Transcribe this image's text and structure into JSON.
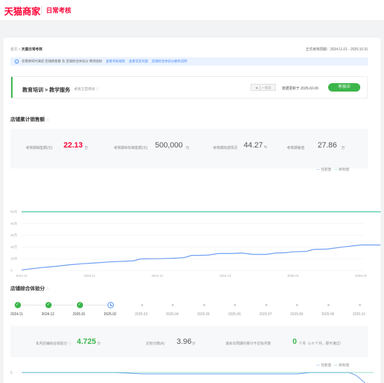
{
  "header": {
    "brand": "天猫商家",
    "subtitle": "日常考核"
  },
  "breadcrumb": {
    "parent": "首页",
    "separator": ">",
    "current": "天猫日常考核"
  },
  "period": "正式考核周期：2024.11.01 - 2025.10.31",
  "notice": {
    "text": "您需要同时满足 店铺销售额 及 店铺综合体验分 两项指标",
    "links": [
      "查看考核规则",
      "查看常见问题",
      "店铺综合体验分解析说明"
    ]
  },
  "category": {
    "path": "教育培训 > 教学服务",
    "kind": "考核主营类目",
    "prev_button": "◀ 上一级类",
    "updated": "数据更新于 2025-02-09",
    "status_button": "考核中"
  },
  "sales": {
    "title": "店铺累计销售额",
    "stats": [
      {
        "label": "考核期销售额(元)",
        "value": "22.13",
        "unit": "万"
      },
      {
        "label": "考核期目标销售额(元)",
        "value": "500,000",
        "unit": "元"
      },
      {
        "label": "考核期完成情况",
        "value": "44.27",
        "unit": "%"
      },
      {
        "label": "考核期差值",
        "value": "27.86",
        "unit": "万"
      }
    ],
    "legend": [
      "当前值",
      "目标值"
    ]
  },
  "chart_data": {
    "type": "line",
    "x_start": "2024-11-01",
    "x_end": "2025-02-09",
    "xticks": [
      "2024.11",
      "2024.11",
      "2024.12",
      "2024.12",
      "2025.01",
      "2025.02"
    ],
    "yticks": [
      "0",
      "10万",
      "20万",
      "30万",
      "40万",
      "50万"
    ],
    "ylim": [
      0,
      50
    ],
    "series": [
      {
        "name": "当前值",
        "color": "#6b9cf2",
        "points": [
          [
            0,
            0.5
          ],
          [
            3,
            1.5
          ],
          [
            6,
            2.5
          ],
          [
            10,
            3.5
          ],
          [
            14,
            4.8
          ],
          [
            18,
            5.8
          ],
          [
            22,
            6.5
          ],
          [
            26,
            7.3
          ],
          [
            30,
            7.8
          ],
          [
            33,
            8.3
          ],
          [
            35,
            9.8
          ],
          [
            40,
            10
          ],
          [
            45,
            10.4
          ],
          [
            48,
            11
          ],
          [
            50,
            12.8
          ],
          [
            52,
            12.8
          ],
          [
            55,
            13.1
          ],
          [
            58,
            14.5
          ],
          [
            62,
            14.5
          ],
          [
            65,
            14.9
          ],
          [
            68,
            13.7
          ],
          [
            72,
            13.7
          ],
          [
            75,
            14.9
          ],
          [
            78,
            15.2
          ],
          [
            80,
            15.9
          ],
          [
            84,
            16.3
          ],
          [
            86,
            17.9
          ],
          [
            90,
            18.2
          ],
          [
            95,
            20.1
          ],
          [
            100,
            21.7
          ],
          [
            105,
            21.7
          ],
          [
            110,
            21.7
          ],
          [
            115,
            21.7
          ],
          [
            120,
            22.2
          ],
          [
            125,
            22.1
          ]
        ]
      },
      {
        "name": "目标值",
        "color": "#3cc8a0",
        "points": [
          [
            0,
            50
          ],
          [
            125,
            50
          ]
        ]
      }
    ]
  },
  "experience": {
    "title": "店铺综合体验分",
    "months": [
      {
        "label": "2024.11",
        "state": "done"
      },
      {
        "label": "2024.12",
        "state": "done"
      },
      {
        "label": "2025.01",
        "state": "done"
      },
      {
        "label": "2025.02",
        "state": "current"
      },
      {
        "label": "2025.03",
        "state": "future"
      },
      {
        "label": "2025.04",
        "state": "future"
      },
      {
        "label": "2025.05",
        "state": "future"
      },
      {
        "label": "2025.06",
        "state": "future"
      },
      {
        "label": "2025.07",
        "state": "future"
      },
      {
        "label": "2025.08",
        "state": "future"
      },
      {
        "label": "2025.09",
        "state": "future"
      },
      {
        "label": "2025.10",
        "state": "future"
      }
    ],
    "scores": [
      {
        "label": "本月店铺综合体验分",
        "value": "4.725",
        "unit": "分"
      },
      {
        "label": "达标分数(A)",
        "value": "3.96",
        "unit": "分"
      },
      {
        "label": "滚余日周期内累计不达标月数",
        "value": "0",
        "unit": "个月（≥ 6 个月，即不通过）"
      }
    ],
    "legend": [
      "当前值",
      "目标值"
    ],
    "ytick": "5"
  }
}
